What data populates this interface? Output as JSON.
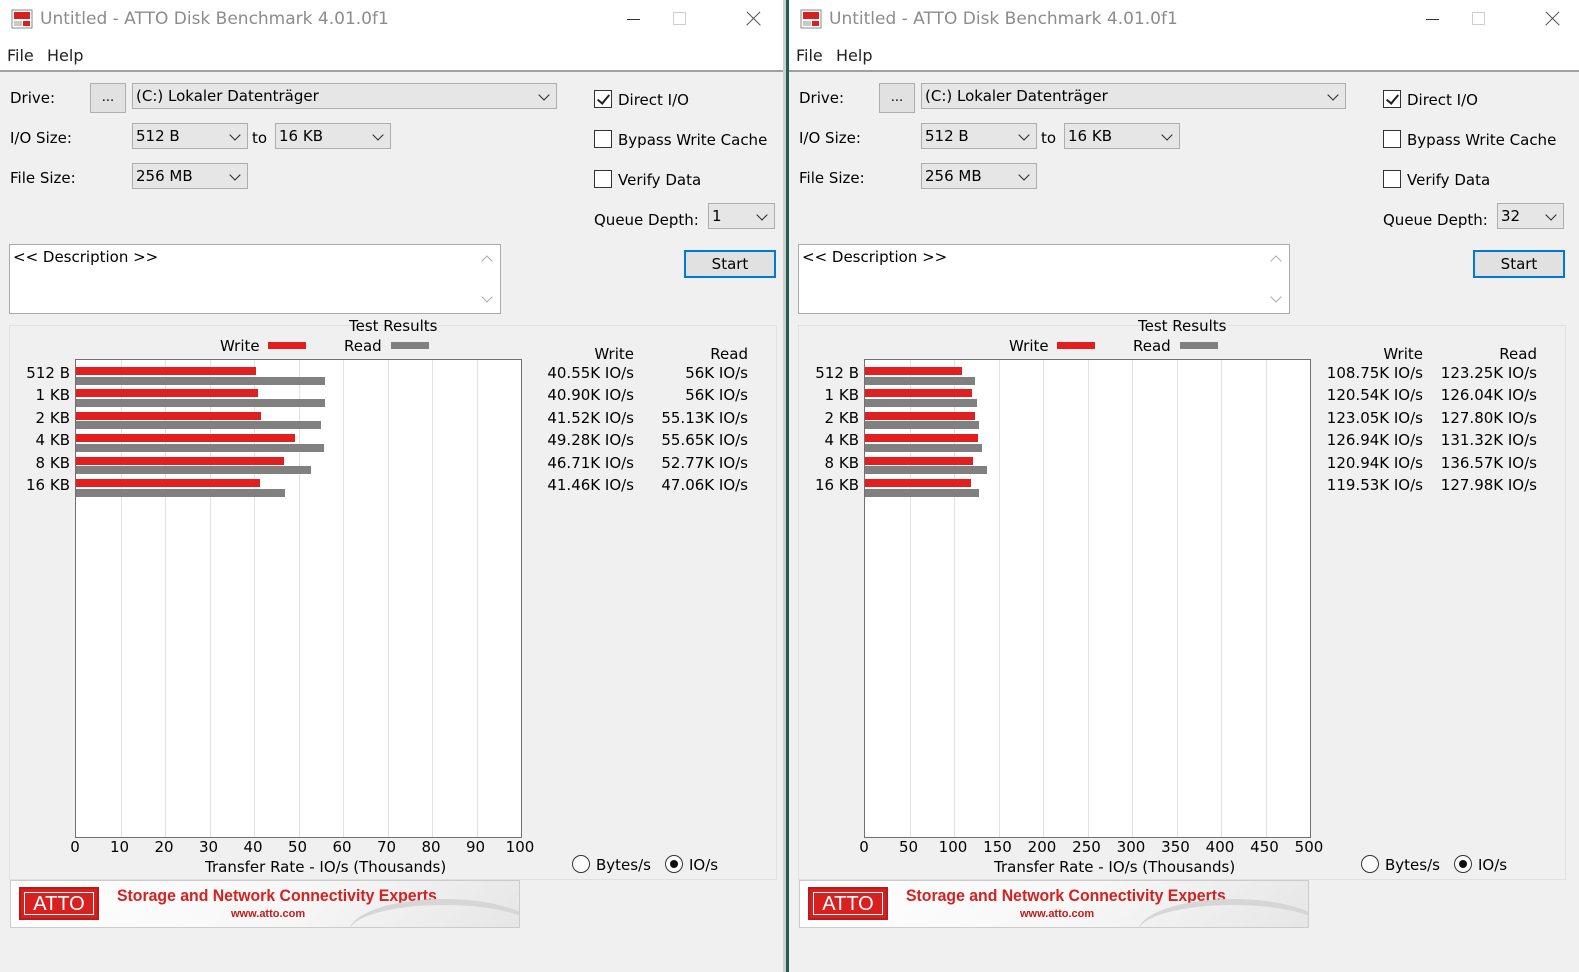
{
  "windows": [
    {
      "title": "Untitled - ATTO Disk Benchmark 4.01.0f1",
      "menu": [
        "File",
        "Help"
      ],
      "drive_label": "Drive:",
      "browse_label": "...",
      "drive_value": "(C:) Lokaler Datenträger",
      "io_size_label": "I/O Size:",
      "io_size_from": "512 B",
      "to_label": "to",
      "io_size_to": "16 KB",
      "file_size_label": "File Size:",
      "file_size_value": "256 MB",
      "direct_io": {
        "label": "Direct I/O",
        "checked": true
      },
      "bypass_write_cache": {
        "label": "Bypass Write Cache",
        "checked": false
      },
      "verify_data": {
        "label": "Verify Data",
        "checked": false
      },
      "queue_depth_label": "Queue Depth:",
      "queue_depth_value": "1",
      "description": "<< Description >>",
      "start_label": "Start",
      "results_title": "Test Results",
      "legend_write": "Write",
      "legend_read": "Read",
      "col_write": "Write",
      "col_read": "Read",
      "axis_label": "Transfer Rate - IO/s (Thousands)",
      "radio_bytes": {
        "label": "Bytes/s",
        "selected": false
      },
      "radio_ios": {
        "label": "IO/s",
        "selected": true
      },
      "banner": {
        "logo": "ATTO",
        "slogan": "Storage and Network Connectivity Experts",
        "url": "www.atto.com"
      },
      "rows": [
        {
          "size": "512 B",
          "write": "40.55K IO/s",
          "read": "56K IO/s"
        },
        {
          "size": "1 KB",
          "write": "40.90K IO/s",
          "read": "56K IO/s"
        },
        {
          "size": "2 KB",
          "write": "41.52K IO/s",
          "read": "55.13K IO/s"
        },
        {
          "size": "4 KB",
          "write": "49.28K IO/s",
          "read": "55.65K IO/s"
        },
        {
          "size": "8 KB",
          "write": "46.71K IO/s",
          "read": "52.77K IO/s"
        },
        {
          "size": "16 KB",
          "write": "41.46K IO/s",
          "read": "47.06K IO/s"
        }
      ]
    },
    {
      "title": "Untitled - ATTO Disk Benchmark 4.01.0f1",
      "menu": [
        "File",
        "Help"
      ],
      "drive_label": "Drive:",
      "browse_label": "...",
      "drive_value": "(C:) Lokaler Datenträger",
      "io_size_label": "I/O Size:",
      "io_size_from": "512 B",
      "to_label": "to",
      "io_size_to": "16 KB",
      "file_size_label": "File Size:",
      "file_size_value": "256 MB",
      "direct_io": {
        "label": "Direct I/O",
        "checked": true
      },
      "bypass_write_cache": {
        "label": "Bypass Write Cache",
        "checked": false
      },
      "verify_data": {
        "label": "Verify Data",
        "checked": false
      },
      "queue_depth_label": "Queue Depth:",
      "queue_depth_value": "32",
      "description": "<< Description >>",
      "start_label": "Start",
      "results_title": "Test Results",
      "legend_write": "Write",
      "legend_read": "Read",
      "col_write": "Write",
      "col_read": "Read",
      "axis_label": "Transfer Rate - IO/s (Thousands)",
      "radio_bytes": {
        "label": "Bytes/s",
        "selected": false
      },
      "radio_ios": {
        "label": "IO/s",
        "selected": true
      },
      "banner": {
        "logo": "ATTO",
        "slogan": "Storage and Network Connectivity Experts",
        "url": "www.atto.com"
      },
      "rows": [
        {
          "size": "512 B",
          "write": "108.75K IO/s",
          "read": "123.25K IO/s"
        },
        {
          "size": "1 KB",
          "write": "120.54K IO/s",
          "read": "126.04K IO/s"
        },
        {
          "size": "2 KB",
          "write": "123.05K IO/s",
          "read": "127.80K IO/s"
        },
        {
          "size": "4 KB",
          "write": "126.94K IO/s",
          "read": "131.32K IO/s"
        },
        {
          "size": "8 KB",
          "write": "120.94K IO/s",
          "read": "136.57K IO/s"
        },
        {
          "size": "16 KB",
          "write": "119.53K IO/s",
          "read": "127.98K IO/s"
        }
      ]
    }
  ],
  "colors": {
    "write": "#e21f1f",
    "read": "#808080",
    "accent": "#0078d7"
  },
  "chart_data": [
    {
      "type": "bar",
      "orientation": "horizontal",
      "title": "Test Results",
      "xlabel": "Transfer Rate - IO/s (Thousands)",
      "xlim": [
        0,
        100
      ],
      "xticks": [
        0,
        10,
        20,
        30,
        40,
        50,
        60,
        70,
        80,
        90,
        100
      ],
      "categories": [
        "512 B",
        "1 KB",
        "2 KB",
        "4 KB",
        "8 KB",
        "16 KB"
      ],
      "series": [
        {
          "name": "Write",
          "values": [
            40.55,
            40.9,
            41.52,
            49.28,
            46.71,
            41.46
          ]
        },
        {
          "name": "Read",
          "values": [
            56.0,
            56.0,
            55.13,
            55.65,
            52.77,
            47.06
          ]
        }
      ],
      "legend": "top-center",
      "grid": true
    },
    {
      "type": "bar",
      "orientation": "horizontal",
      "title": "Test Results",
      "xlabel": "Transfer Rate - IO/s (Thousands)",
      "xlim": [
        0,
        500
      ],
      "xticks": [
        0,
        50,
        100,
        150,
        200,
        250,
        300,
        350,
        400,
        450,
        500
      ],
      "categories": [
        "512 B",
        "1 KB",
        "2 KB",
        "4 KB",
        "8 KB",
        "16 KB"
      ],
      "series": [
        {
          "name": "Write",
          "values": [
            108.75,
            120.54,
            123.05,
            126.94,
            120.94,
            119.53
          ]
        },
        {
          "name": "Read",
          "values": [
            123.25,
            126.04,
            127.8,
            131.32,
            136.57,
            127.98
          ]
        }
      ],
      "legend": "top-center",
      "grid": true
    }
  ]
}
